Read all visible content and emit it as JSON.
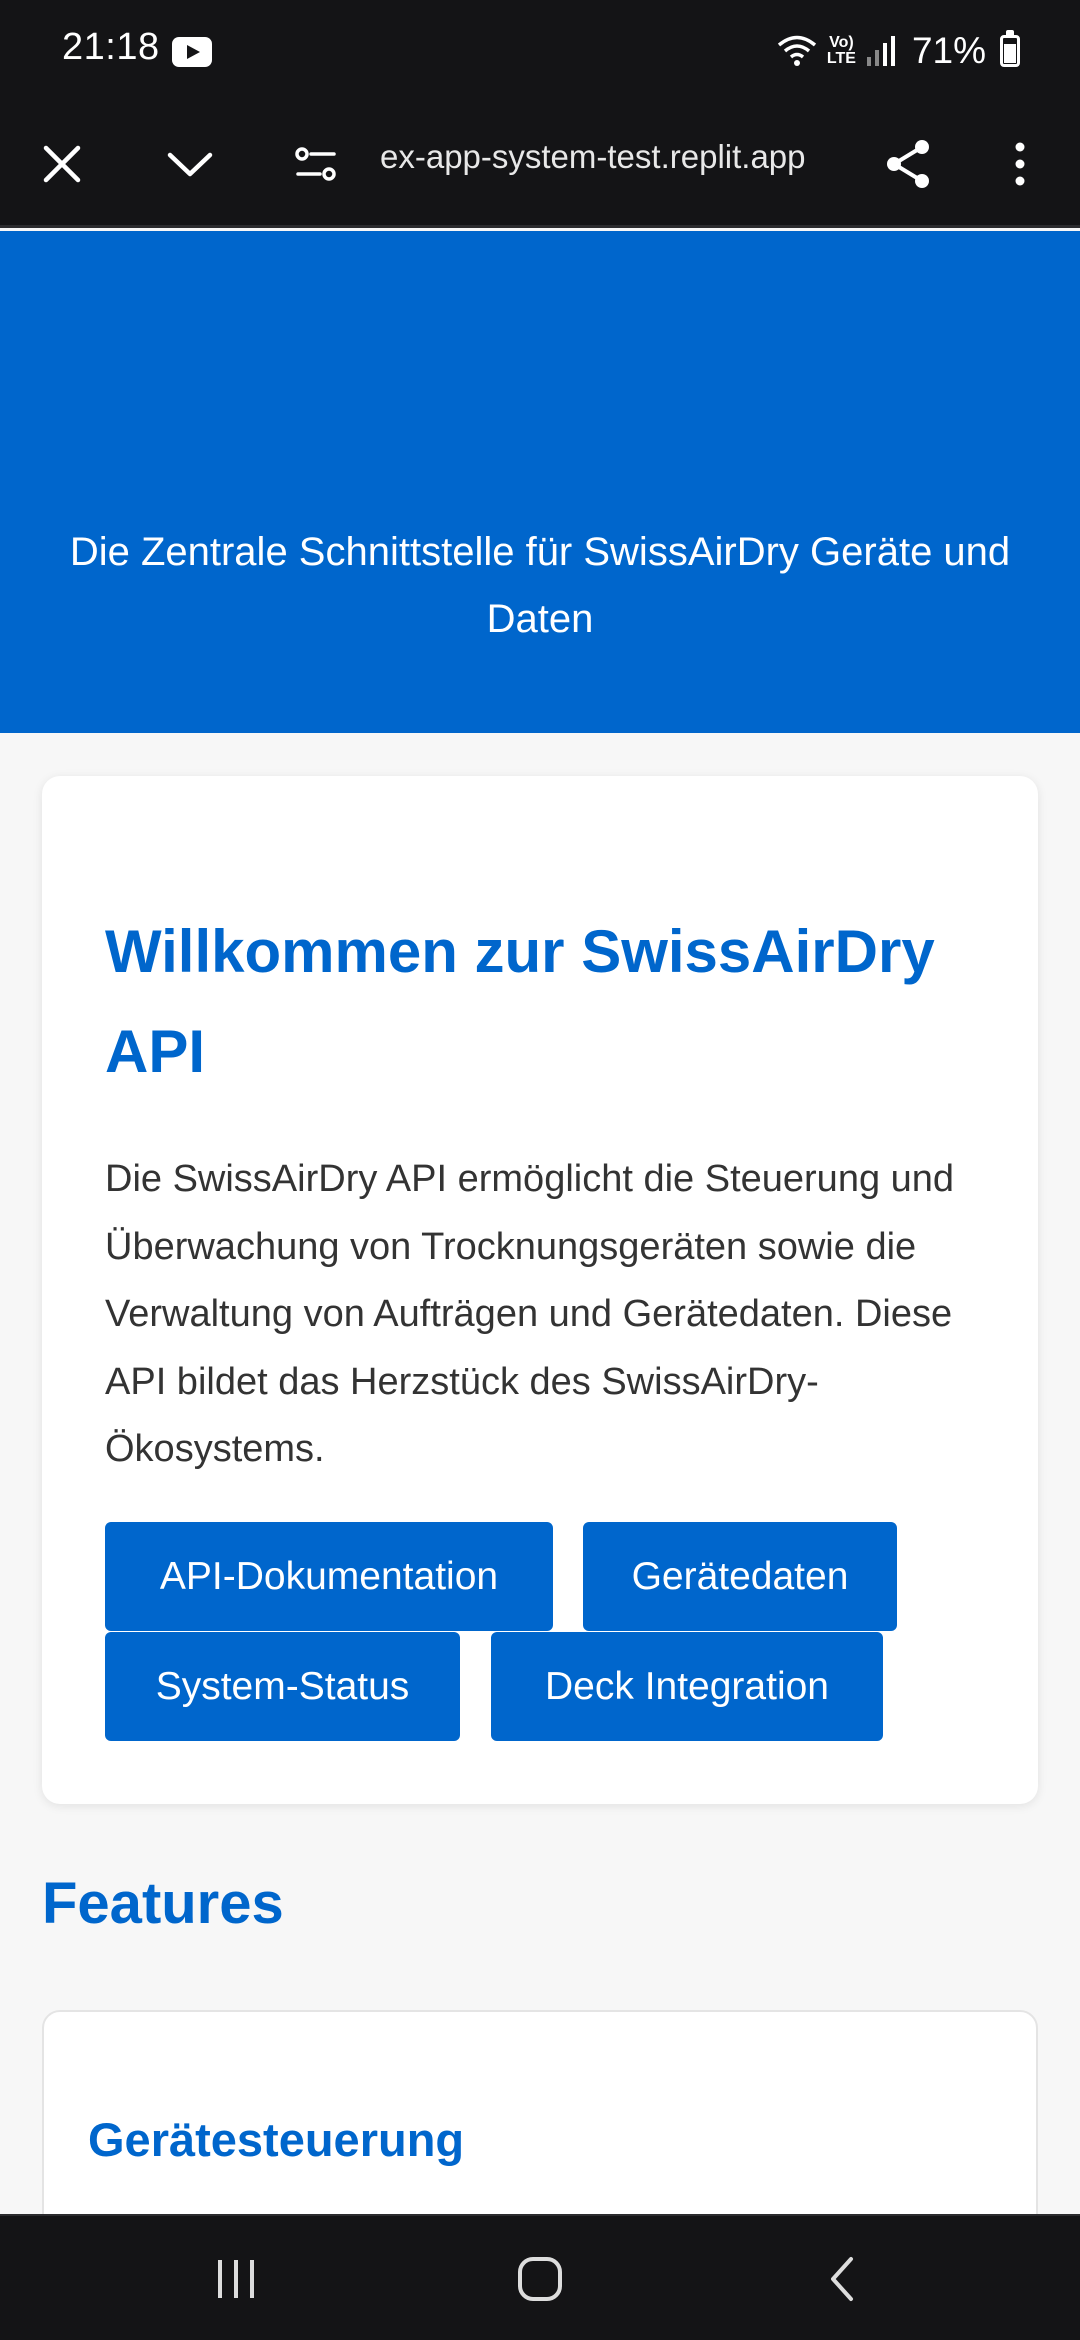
{
  "status_bar": {
    "time": "21:18",
    "volte_line1": "Vo)",
    "volte_line2": "LTE",
    "battery": "71%",
    "icons": [
      "youtube-icon",
      "wifi-icon",
      "signal-icon",
      "battery-icon"
    ]
  },
  "browser": {
    "url": "ex-app-system-test.replit.app",
    "icons": [
      "close-icon",
      "chevron-down-icon",
      "site-settings-icon",
      "share-icon",
      "more-vert-icon"
    ]
  },
  "hero": {
    "tagline": "Die Zentrale Schnittstelle für SwissAirDry Geräte und Daten"
  },
  "welcome": {
    "title": "Willkommen zur SwissAirDry API",
    "text": "Die SwissAirDry API ermöglicht die Steuerung und Überwachung von Trocknungsgeräten sowie die Verwaltung von Aufträgen und Gerätedaten. Diese API bildet das Herzstück des SwissAirDry-Ökosystems.",
    "buttons": [
      "API-Dokumentation",
      "Gerätedaten",
      "System-Status",
      "Deck Integration"
    ]
  },
  "features": {
    "heading": "Features",
    "items": [
      {
        "title": "Gerätesteuerung"
      }
    ]
  },
  "nav_bar": {
    "icons": [
      "recents-icon",
      "home-icon",
      "back-icon"
    ]
  },
  "colors": {
    "brand_blue": "#0066cc",
    "system_bar": "#141416",
    "page_bg": "#f7f7f7"
  }
}
